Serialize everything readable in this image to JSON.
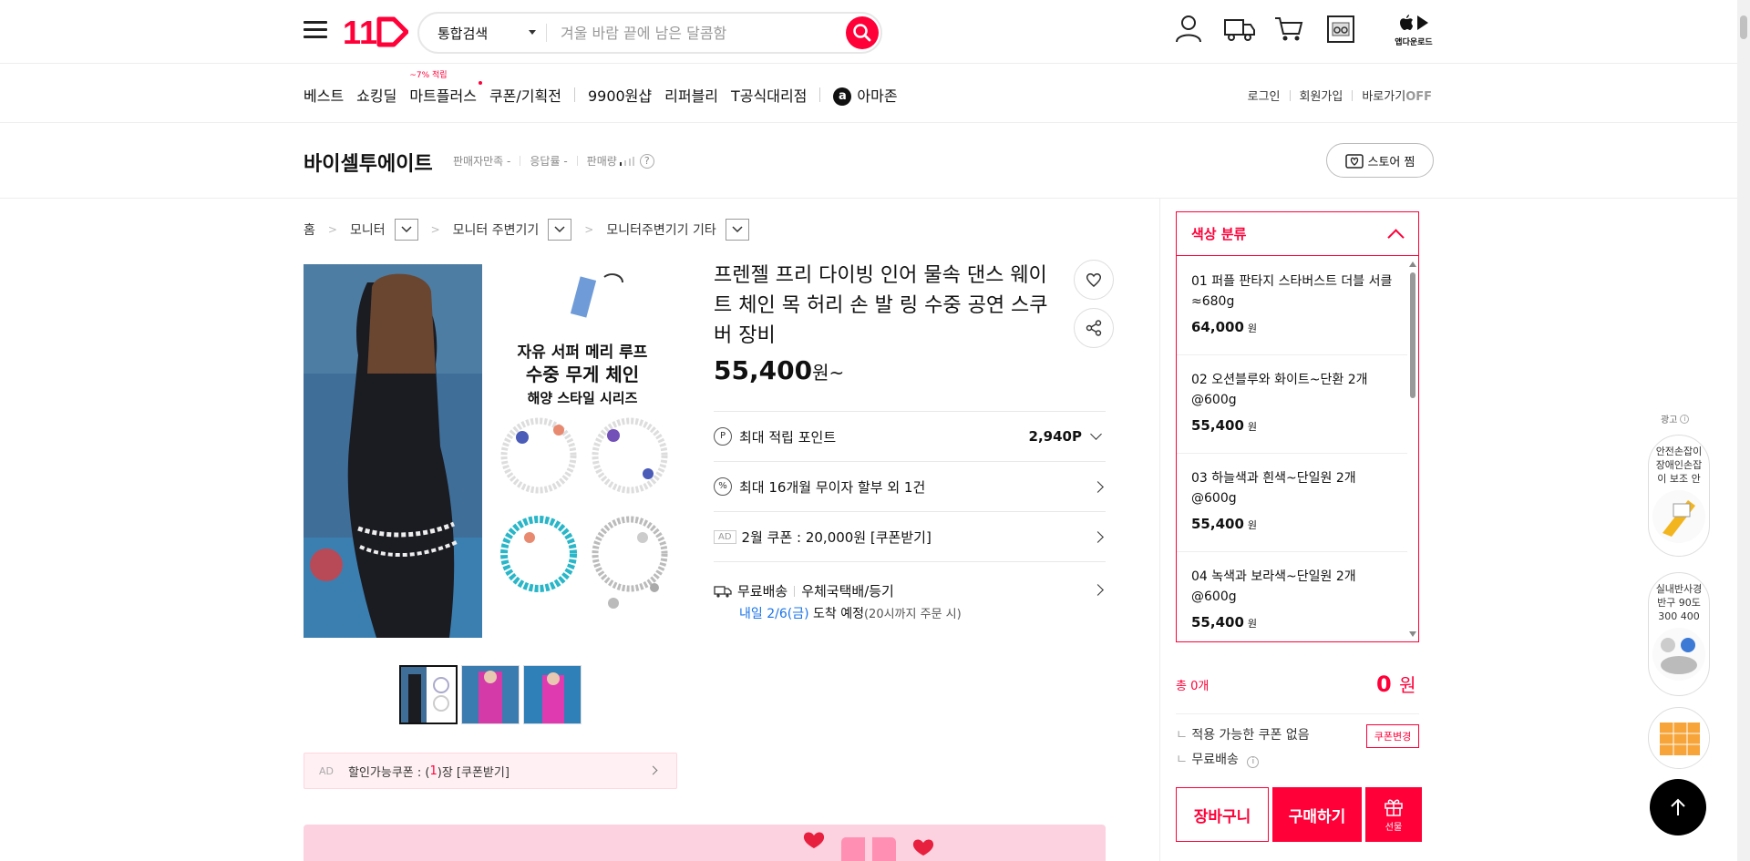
{
  "header": {
    "logo_text": "11",
    "search": {
      "category": "통합검색",
      "placeholder": "겨울 바람 끝에 남은 달콤함"
    },
    "app_download_label": "앱다운로드"
  },
  "nav": {
    "items": [
      {
        "label": "베스트"
      },
      {
        "label": "쇼킹딜"
      },
      {
        "label": "마트플러스",
        "badge": "~7% 적립"
      },
      {
        "label": "쿠폰/기획전"
      },
      {
        "label": "9900원샵"
      },
      {
        "label": "리퍼블리"
      },
      {
        "label": "T공식대리점"
      },
      {
        "label": "아마존"
      }
    ],
    "amazon_logo": "a",
    "right": {
      "login": "로그인",
      "signup": "회원가입",
      "shortcut": "바로가기",
      "shortcut_state": "OFF"
    }
  },
  "store": {
    "name": "바이셀투에이트",
    "meta": [
      "판매자만족",
      "응답률",
      "판매량"
    ],
    "meta_value": "-",
    "help": "?",
    "fav_label": "스토어 찜"
  },
  "breadcrumb": [
    "홈",
    "모니터",
    "모니터 주변기기",
    "모니터주변기기 기타"
  ],
  "product": {
    "image_text": [
      "자유 서퍼 메리 루프",
      "수중 무게 체인",
      "해양 스타일 시리즈"
    ],
    "title": "프렌젤 프리 다이빙 인어 물속 댄스 웨이트 체인 목 허리 손 발 링 수중 공연 스쿠버 장비",
    "price": "55,400",
    "price_unit": "원~",
    "rows": {
      "points_icon": "P",
      "points_label": "최대 적립 포인트",
      "points_value": "2,940P",
      "installment_icon": "%",
      "installment_label": "최대 16개월 무이자 할부 외 1건",
      "ad_tag": "AD",
      "coupon_label": "2월 쿠폰 : 20,000원 [쿠폰받기]",
      "delivery_label": "무료배송",
      "delivery_method": "우체국택배/등기",
      "arrival_date": "내일 2/6(금)",
      "arrival_suffix": "도착 예정",
      "arrival_note": "(20시까지 주문 시)"
    },
    "coupon_bar": {
      "ad": "AD",
      "prefix": "할인가능쿠폰 : (",
      "count": "1",
      "suffix": ")장 [쿠폰받기]"
    }
  },
  "options": {
    "title": "색상 분류",
    "currency": "원",
    "items": [
      {
        "name": "01 퍼플 판타지 스타버스트 더블 서클 ≈680g",
        "price": "64,000"
      },
      {
        "name": "02 오션블루와 화이트~단환 2개 @600g",
        "price": "55,400"
      },
      {
        "name": "03 하늘색과 흰색~단일원 2개@600g",
        "price": "55,400"
      },
      {
        "name": "04 녹색과 보라색~단일원 2개@600g",
        "price": "55,400"
      }
    ]
  },
  "summary": {
    "total_label": "총 0개",
    "total_value": "0",
    "total_unit": "원",
    "no_coupon": "적용 가능한 쿠폰 없음",
    "coupon_change": "쿠폰변경",
    "free_shipping": "무료배송",
    "cart": "장바구니",
    "buy": "구매하기",
    "gift": "선물"
  },
  "rail": {
    "ad_label": "광고",
    "cards": [
      "안전손잡이 장애인손잡이 보조 안",
      "실내반사경 반구 90도 300 400"
    ]
  },
  "colors": {
    "brand": "#ff0038",
    "link_blue": "#1a73e8"
  }
}
